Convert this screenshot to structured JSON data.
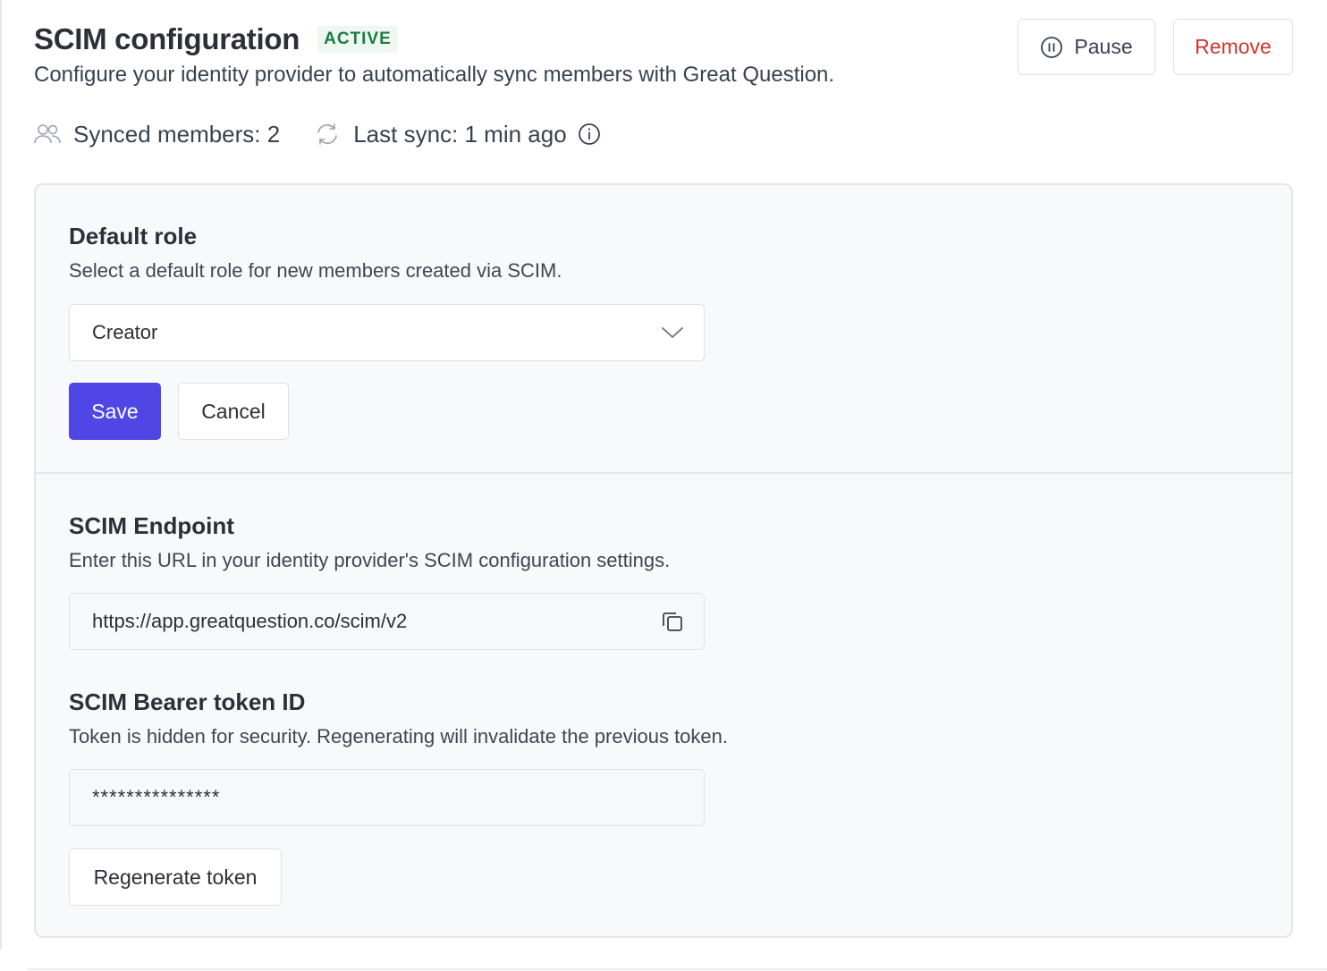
{
  "header": {
    "title": "SCIM configuration",
    "status_badge": "ACTIVE",
    "subtitle": "Configure your identity provider to automatically sync members with Great Question."
  },
  "stats": {
    "synced_members": "Synced members: 2",
    "last_sync": "Last sync: 1 min ago"
  },
  "actions": {
    "pause_label": "Pause",
    "remove_label": "Remove"
  },
  "default_role": {
    "title": "Default role",
    "description": "Select a default role for new members created via SCIM.",
    "selected": "Creator",
    "save_label": "Save",
    "cancel_label": "Cancel"
  },
  "endpoint": {
    "title": "SCIM Endpoint",
    "description": "Enter this URL in your identity provider's SCIM configuration settings.",
    "url": "https://app.greatquestion.co/scim/v2"
  },
  "token": {
    "title": "SCIM Bearer token ID",
    "description": "Token is hidden for security. Regenerating will invalidate the previous token.",
    "masked_value": "***************",
    "regenerate_label": "Regenerate token"
  },
  "icons": {
    "members": "users-icon",
    "sync": "refresh-icon",
    "info": "info-icon",
    "pause": "pause-circle-icon",
    "dropdown": "chevron-down-icon",
    "copy": "copy-icon"
  },
  "colors": {
    "primary": "#4f46e5",
    "danger": "#c8372d",
    "success_text": "#1c7c43",
    "success_bg": "#eef8f1"
  }
}
